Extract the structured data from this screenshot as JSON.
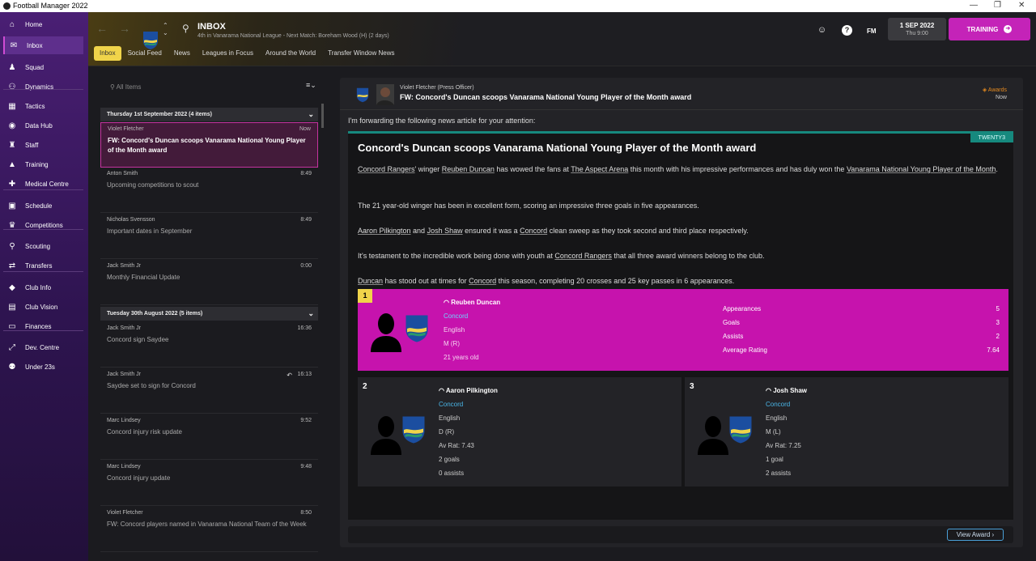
{
  "window": {
    "title": "Football Manager 2022",
    "controls": [
      "—",
      "❐",
      "✕"
    ]
  },
  "sidebar": {
    "items": [
      {
        "label": "Home",
        "icon": "home-icon",
        "glyph": "⌂"
      },
      {
        "label": "Inbox",
        "icon": "inbox-icon",
        "glyph": "✉",
        "active": true
      },
      {
        "label": "Squad",
        "icon": "shirt-icon",
        "glyph": "♟"
      },
      {
        "label": "Dynamics",
        "icon": "dynamics-icon",
        "glyph": "⚇"
      },
      {
        "label": "Tactics",
        "icon": "tactics-board-icon",
        "glyph": "▦"
      },
      {
        "label": "Data Hub",
        "icon": "data-hub-icon",
        "glyph": "◉"
      },
      {
        "label": "Staff",
        "icon": "staff-icon",
        "glyph": "♜"
      },
      {
        "label": "Training",
        "icon": "training-cone-icon",
        "glyph": "▲"
      },
      {
        "label": "Medical Centre",
        "icon": "medical-icon",
        "glyph": "✚"
      },
      {
        "label": "Schedule",
        "icon": "calendar-icon",
        "glyph": "▣"
      },
      {
        "label": "Competitions",
        "icon": "trophy-icon",
        "glyph": "♛"
      },
      {
        "label": "Scouting",
        "icon": "scouting-icon",
        "glyph": "⚲"
      },
      {
        "label": "Transfers",
        "icon": "transfers-icon",
        "glyph": "⇄"
      },
      {
        "label": "Club Info",
        "icon": "shield-icon",
        "glyph": "◆"
      },
      {
        "label": "Club Vision",
        "icon": "briefcase-icon",
        "glyph": "▤"
      },
      {
        "label": "Finances",
        "icon": "finances-icon",
        "glyph": "▭"
      },
      {
        "label": "Dev. Centre",
        "icon": "dev-centre-icon",
        "glyph": "⤢"
      },
      {
        "label": "Under 23s",
        "icon": "under23-icon",
        "glyph": "⚉"
      }
    ]
  },
  "header": {
    "title": "INBOX",
    "subtitle": "4th in Vanarama National League - Next Match: Boreham Wood (H) (2 days)",
    "fm_label": "FM",
    "help": "?",
    "date": "1 SEP 2022",
    "day_time": "Thu 9:00",
    "continue_label": "TRAINING"
  },
  "tabs": [
    "Inbox",
    "Social Feed",
    "News",
    "Leagues in Focus",
    "Around the World",
    "Transfer Window News"
  ],
  "list": {
    "search_placeholder": "All Items",
    "groups": [
      {
        "label": "Thursday 1st September 2022 (4 items)",
        "items": [
          {
            "sender": "Violet Fletcher",
            "time": "Now",
            "subject": "FW: Concord's Duncan scoops Vanarama National Young Player of the Month award",
            "selected": true
          },
          {
            "sender": "Anton Smith",
            "time": "8:49",
            "subject": "Upcoming competitions to scout"
          },
          {
            "sender": "Nicholas Svensson",
            "time": "8:49",
            "subject": "Important dates in September"
          },
          {
            "sender": "Jack Smith Jr",
            "time": "0:00",
            "subject": "Monthly Financial Update"
          }
        ]
      },
      {
        "label": "Tuesday 30th August 2022 (5 items)",
        "items": [
          {
            "sender": "Jack Smith Jr",
            "time": "16:36",
            "subject": "Concord sign Saydee"
          },
          {
            "sender": "Jack Smith Jr",
            "time": "16:13",
            "subject": "Saydee set to sign for Concord",
            "reply": "↶"
          },
          {
            "sender": "Marc Lindsey",
            "time": "9:52",
            "subject": "Concord injury risk update"
          },
          {
            "sender": "Marc Lindsey",
            "time": "9:48",
            "subject": "Concord injury update"
          },
          {
            "sender": "Violet Fletcher",
            "time": "8:50",
            "subject": "FW: Concord players named in Vanarama National Team of the Week"
          }
        ]
      }
    ]
  },
  "message": {
    "sender": "Violet Fletcher  (Press Officer)",
    "subject": "FW: Concord's Duncan scoops Vanarama National Young Player of the Month award",
    "tag": "Awards",
    "time": "Now",
    "intro": "I'm forwarding the following news article for your attention:",
    "source": "TWENTY3",
    "headline": "Concord's Duncan scoops Vanarama National Young Player of the Month award",
    "p1": {
      "a": "Concord Rangers",
      "b": "' winger ",
      "c": "Reuben Duncan",
      "d": " has wowed the fans at ",
      "e": "The Aspect Arena",
      "f": " this month with his impressive performances and has duly won the ",
      "g": "Vanarama National Young Player of the Month",
      "h": "."
    },
    "p2": "The 21 year-old winger has been in excellent form, scoring an impressive three goals in five appearances.",
    "p3": {
      "a": "Aaron Pilkington",
      "b": " and ",
      "c": "Josh Shaw",
      "d": " ensured it was a ",
      "e": "Concord",
      "f": " clean sweep as they took second and third place respectively."
    },
    "p4": {
      "a": "It's testament to the incredible work being done with youth at ",
      "b": "Concord Rangers",
      "c": " that all three award winners belong to the club."
    },
    "p5": {
      "a": "Duncan",
      "b": " has stood out at times for ",
      "c": "Concord",
      "d": " this season, completing 20 crosses and 25 key passes in 6 appearances."
    },
    "winner": {
      "rank": "1",
      "name": "Reuben Duncan",
      "club": "Concord",
      "nat": "English",
      "pos": "M (R)",
      "age": "21 years old",
      "stats": [
        [
          "Appearances",
          "5"
        ],
        [
          "Goals",
          "3"
        ],
        [
          "Assists",
          "2"
        ],
        [
          "Average Rating",
          "7.64"
        ]
      ]
    },
    "second": {
      "rank": "2",
      "name": "Aaron Pilkington",
      "club": "Concord",
      "nat": "English",
      "pos": "D (R)",
      "rat": "Av Rat: 7.43",
      "l1": "2 goals",
      "l2": "0 assists"
    },
    "third": {
      "rank": "3",
      "name": "Josh Shaw",
      "club": "Concord",
      "nat": "English",
      "pos": "M (L)",
      "rat": "Av Rat: 7.25",
      "l1": "1 goal",
      "l2": "2 assists"
    },
    "view_award": "View Award"
  }
}
